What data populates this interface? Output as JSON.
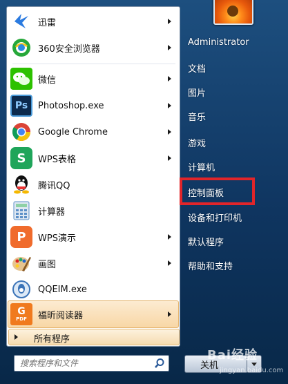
{
  "user": {
    "name": "Administrator"
  },
  "left_items": [
    {
      "label": "迅雷",
      "icon": "xunlei-icon",
      "color": "#2b7be0"
    },
    {
      "label": "360安全浏览器",
      "icon": "360-browser-icon",
      "color": "#27a83a"
    },
    {
      "label": "微信",
      "icon": "wechat-icon",
      "color": "#2dc100"
    },
    {
      "label": "Photoshop.exe",
      "icon": "photoshop-icon",
      "color": "#0c2a4d"
    },
    {
      "label": "Google Chrome",
      "icon": "chrome-icon",
      "color": "#4285f4"
    },
    {
      "label": "WPS表格",
      "icon": "wps-sheet-icon",
      "color": "#1fa55a"
    },
    {
      "label": "腾讯QQ",
      "icon": "qq-icon",
      "color": "#111111"
    },
    {
      "label": "计算器",
      "icon": "calculator-icon",
      "color": "#5b8fc7"
    },
    {
      "label": "WPS演示",
      "icon": "wps-presentation-icon",
      "color": "#f06b2c"
    },
    {
      "label": "画图",
      "icon": "paint-icon",
      "color": "#d68a2c"
    },
    {
      "label": "QQEIM.exe",
      "icon": "qqeim-icon",
      "color": "#3b74b8"
    },
    {
      "label": "福昕阅读器",
      "icon": "foxit-reader-icon",
      "color": "#f07a1e",
      "icon_text": "PDF"
    }
  ],
  "all_programs": "所有程序",
  "search": {
    "placeholder": "搜索程序和文件"
  },
  "right_items": [
    "文档",
    "图片",
    "音乐",
    "游戏",
    "计算机",
    "控制面板",
    "设备和打印机",
    "默认程序",
    "帮助和支持"
  ],
  "shutdown": {
    "label": "关机"
  },
  "watermark": {
    "text": "Bai经验",
    "sub": "jingyan.baidu.com"
  },
  "colors": {
    "highlight_box": "#e1252a",
    "menu_bg": "#0f3560",
    "hover_bg": "#f8d7a6"
  }
}
